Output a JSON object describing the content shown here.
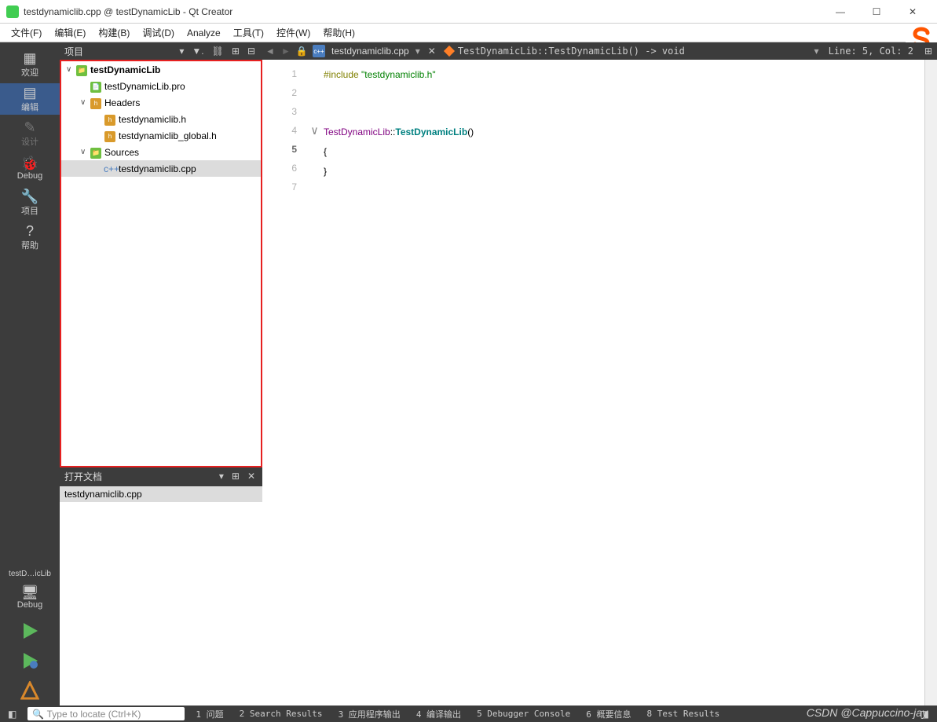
{
  "window": {
    "title": "testdynamiclib.cpp @ testDynamicLib - Qt Creator"
  },
  "menu": {
    "file": "文件(F)",
    "edit": "编辑(E)",
    "build": "构建(B)",
    "debug": "调试(D)",
    "analyze": "Analyze",
    "tools": "工具(T)",
    "widgets": "控件(W)",
    "help": "帮助(H)"
  },
  "left_tools": {
    "welcome": "欢迎",
    "edit": "编辑",
    "design": "设计",
    "debug": "Debug",
    "project": "项目",
    "help": "帮助"
  },
  "left_bottom": {
    "project_label": "testD…icLib",
    "monitor": "🖥",
    "debug": "Debug"
  },
  "project_panel": {
    "title": "项目",
    "items": [
      {
        "indent": 0,
        "chev": "∨",
        "icon": "📁",
        "label": "testDynamicLib",
        "bold": true,
        "iconcol": "#6fbf3f"
      },
      {
        "indent": 1,
        "chev": "",
        "icon": "📄",
        "label": "testDynamicLib.pro",
        "iconcol": "#6fbf3f"
      },
      {
        "indent": 1,
        "chev": "∨",
        "icon": "h",
        "label": "Headers",
        "iconcol": "#d99a2b"
      },
      {
        "indent": 2,
        "chev": "",
        "icon": "h",
        "label": "testdynamiclib.h",
        "iconcol": "#d99a2b"
      },
      {
        "indent": 2,
        "chev": "",
        "icon": "h",
        "label": "testdynamiclib_global.h",
        "iconcol": "#d99a2b"
      },
      {
        "indent": 1,
        "chev": "∨",
        "icon": "📁",
        "label": "Sources",
        "iconcol": "#6fbf3f"
      },
      {
        "indent": 2,
        "chev": "",
        "icon": "c++",
        "label": "testdynamiclib.cpp",
        "selected": true,
        "iconcol": "#4a7dbf"
      }
    ]
  },
  "open_docs": {
    "title": "打开文档",
    "items": [
      "testdynamiclib.cpp"
    ]
  },
  "editor_tab": {
    "filename": "testdynamiclib.cpp",
    "breadcrumb": "TestDynamicLib::TestDynamicLib() -> void",
    "position": "Line: 5, Col: 2"
  },
  "code": {
    "lines": [
      1,
      2,
      3,
      4,
      5,
      6,
      7
    ],
    "current": 5,
    "include_kw": "#include ",
    "include_str": "\"testdynamiclib.h\"",
    "class_name": "TestDynamicLib",
    "scope": "::",
    "ctor": "TestDynamicLib",
    "parens": "()",
    "brace_open": "{",
    "brace_close": "}"
  },
  "bottom": {
    "locator_placeholder": "Type to locate (Ctrl+K)",
    "outputs": [
      "1 问题",
      "2 Search Results",
      "3 应用程序输出",
      "4 编译输出",
      "5 Debugger Console",
      "6 概要信息",
      "8 Test Results"
    ]
  },
  "watermark": "CSDN @Cappuccino-jay"
}
